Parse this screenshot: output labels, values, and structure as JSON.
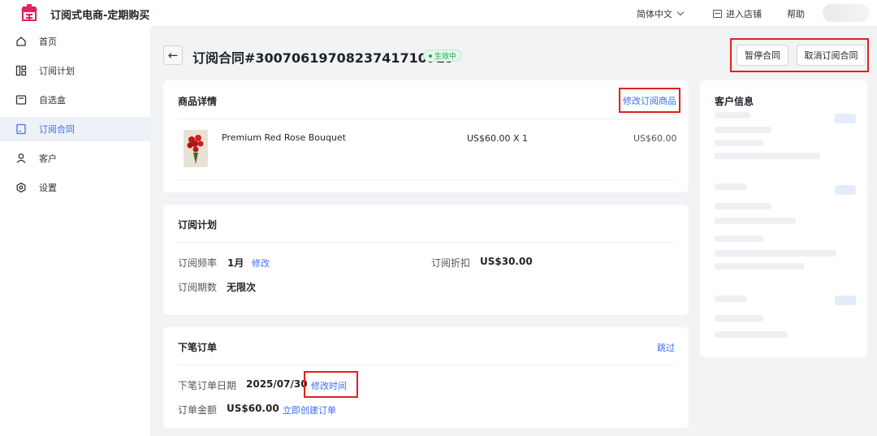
{
  "header": {
    "app_title": "订阅式电商-定期购买",
    "language": "简体中文",
    "enter_store": "进入店铺",
    "help": "帮助",
    "brand_color": "#e0245e"
  },
  "sidebar": {
    "items": [
      {
        "label": "首页",
        "icon": "home-icon"
      },
      {
        "label": "订阅计划",
        "icon": "grid-icon"
      },
      {
        "label": "自选盒",
        "icon": "box-icon"
      },
      {
        "label": "订阅合同",
        "icon": "document-icon",
        "active": true
      },
      {
        "label": "客户",
        "icon": "user-icon"
      },
      {
        "label": "设置",
        "icon": "settings-icon"
      }
    ]
  },
  "page": {
    "title": "订阅合同#3007061970823741710729",
    "status": "生效中",
    "pause_button": "暂停合同",
    "cancel_button": "取消订阅合同"
  },
  "product_details": {
    "title": "商品详情",
    "edit_link": "修改订阅商品",
    "items": [
      {
        "name": "Premium Red Rose Bouquet",
        "unit_price_qty": "US$60.00 X 1",
        "total": "US$60.00"
      }
    ]
  },
  "subscription_plan": {
    "title": "订阅计划",
    "frequency_label": "订阅频率",
    "frequency_value": "1月",
    "frequency_edit": "修改",
    "discount_label": "订阅折扣",
    "discount_value": "US$30.00",
    "periods_label": "订阅期数",
    "periods_value": "无限次"
  },
  "next_order": {
    "title": "下笔订单",
    "skip_link": "跳过",
    "date_label": "下笔订单日期",
    "date_value": "2025/07/30",
    "change_time_link": "修改时间",
    "amount_label": "订单金额",
    "amount_value": "US$60.00",
    "create_now_link": "立即创建订单"
  },
  "customer": {
    "title": "客户信息"
  }
}
